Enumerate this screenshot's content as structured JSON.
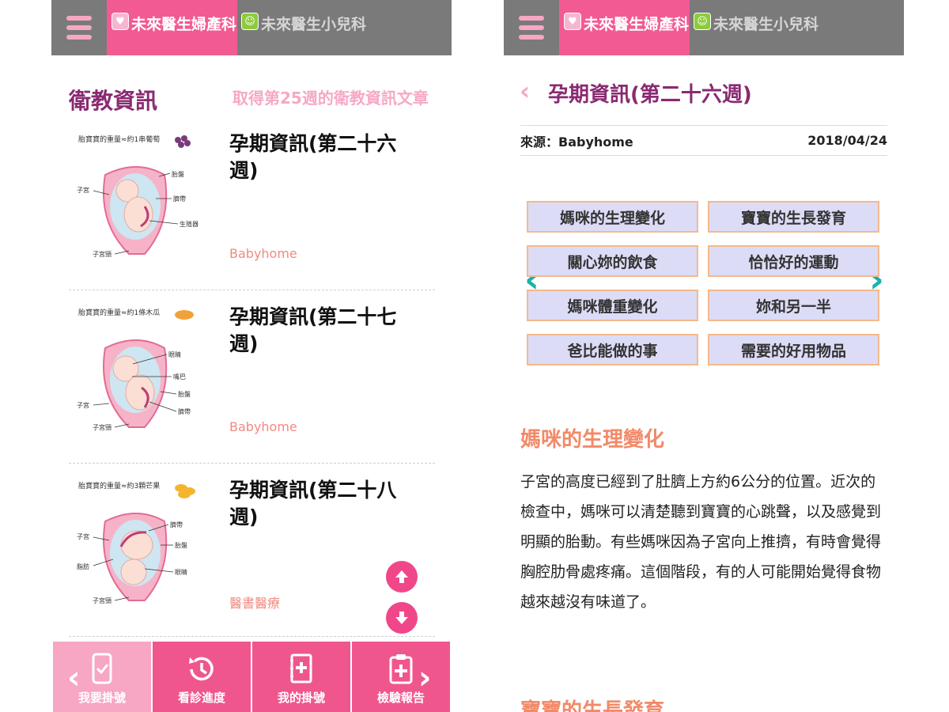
{
  "header": {
    "tab_active": "未來醫生婦產科",
    "tab_inactive": "未來醫生小兒科"
  },
  "left": {
    "section_title": "衛教資訊",
    "fetch_link": "取得第25週的衛教資訊文章",
    "articles": [
      {
        "title": "孕期資訊(第二十六週)",
        "source": "Babyhome",
        "thumb_caption": "胎寶寶的重量≈約1串葡萄",
        "thumb_labels": [
          "胎盤",
          "子宮",
          "臍帶",
          "生殖器",
          "子宮頸"
        ]
      },
      {
        "title": "孕期資訊(第二十七週)",
        "source": "Babyhome",
        "thumb_caption": "胎寶寶的重量≈約1條木瓜",
        "thumb_labels": [
          "眼睛",
          "嘴巴",
          "子宮",
          "胎盤",
          "臍帶",
          "子宮頸"
        ]
      },
      {
        "title": "孕期資訊(第二十八週)",
        "source": "醫書醫療",
        "thumb_caption": "胎寶寶的重量≈約3顆芒果",
        "thumb_labels": [
          "臍帶",
          "子宮",
          "胎盤",
          "脂肪",
          "眼睛",
          "子宮頸"
        ]
      }
    ],
    "bottom_nav": [
      {
        "label": "我要掛號",
        "icon": "phone-check-icon"
      },
      {
        "label": "看診進度",
        "icon": "history-clock-icon"
      },
      {
        "label": "我的掛號",
        "icon": "medical-book-icon"
      },
      {
        "label": "檢驗報告",
        "icon": "clipboard-plus-icon"
      }
    ]
  },
  "right": {
    "title": "孕期資訊(第二十六週)",
    "source": "來源：Babyhome",
    "date": "2018/04/24",
    "categories": [
      "媽咪的生理變化",
      "寶寶的生長發育",
      "關心妳的飲食",
      "恰恰好的運動",
      "媽咪體重變化",
      "妳和另一半",
      "爸比能做的事",
      "需要的好用物品"
    ],
    "section1_heading": "媽咪的生理變化",
    "section1_text": "子宮的高度已經到了肚臍上方約6公分的位置。近次的檢查中，媽咪可以清楚聽到寶寶的心跳聲，以及感覺到明顯的胎動。有些媽咪因為子宮向上推擠，有時會覺得胸腔肋骨處疼痛。這個階段，有的人可能開始覺得食物越來越沒有味道了。",
    "section2_heading": "寶寶的生長發育"
  },
  "colors": {
    "header_gray": "#7a7a7a",
    "brand_pink": "#f25a93",
    "title_purple": "#8a2a72",
    "heading_orange": "#f28a68",
    "teal_arrow": "#17b3a8"
  }
}
